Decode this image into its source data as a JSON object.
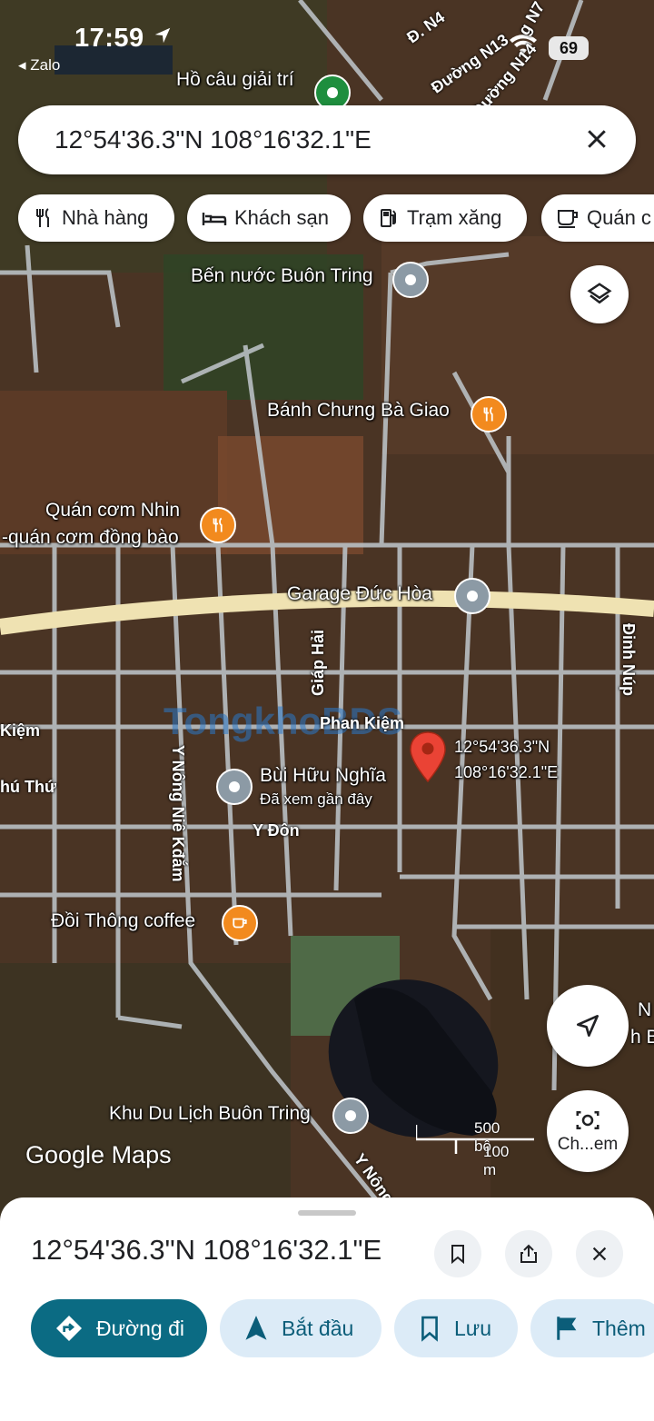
{
  "status_bar": {
    "time": "17:59",
    "back_app": "◂ Zalo",
    "battery": "69"
  },
  "search": {
    "query": "12°54'36.3\"N 108°16'32.1\"E"
  },
  "chips": [
    {
      "label": "Nhà hàng",
      "icon": "restaurant-icon"
    },
    {
      "label": "Khách sạn",
      "icon": "hotel-icon"
    },
    {
      "label": "Trạm xăng",
      "icon": "gas-station-icon"
    },
    {
      "label": "Quán c",
      "icon": "cafe-icon"
    }
  ],
  "map": {
    "places": {
      "ho_cau": "Hồ câu giải trí",
      "ben_nuoc": "Bến nước Buôn Tring",
      "banh_chung": "Bánh Chưng Bà Giao",
      "quan_com_1": "Quán cơm Nhin",
      "quan_com_2": "-quán cơm đồng bào",
      "garage": "Garage Đức Hòa",
      "bui_huu_nghia": "Bùi Hữu Nghĩa",
      "recently_viewed": "Đã xem gần đây",
      "doi_thong": "Đồi Thông coffee",
      "khu_du_lich": "Khu Du Lịch Buôn Tring"
    },
    "streets": {
      "d_n4": "Đ. N4",
      "duong_n13": "Đường N13",
      "duong_n14": "Đường N14",
      "n7": "g N7",
      "giap_hai": "Giáp Hải",
      "phan_kiem": "Phan Kiệm",
      "kiem_left": "Kiệm",
      "thu_left": "hú Thứ",
      "y_nong_nie": "Y Nông Niê Kđắm",
      "y_don": "Y Đôn",
      "dinh_nup": "Đinh Núp",
      "y_nong_bottom": "Y Nông",
      "right_n": "N",
      "right_hb": "h B"
    },
    "pin_coords_lat": "12°54'36.3\"N",
    "pin_coords_lng": "108°16'32.1\"E",
    "watermark": "TongkhoBDS",
    "scale_ft": "500 bộ",
    "scale_m": "100 m",
    "logo": "Google Maps",
    "screenshot_button_label": "Ch...em"
  },
  "sheet": {
    "title": "12°54'36.3\"N 108°16'32.1\"E",
    "actions": [
      {
        "label": "Đường đi",
        "icon": "directions-icon"
      },
      {
        "label": "Bắt đầu",
        "icon": "navigation-arrow-icon"
      },
      {
        "label": "Lưu",
        "icon": "bookmark-icon"
      },
      {
        "label": "Thêm",
        "icon": "flag-icon"
      }
    ]
  },
  "colors": {
    "accent": "#0b6b83",
    "pin_red": "#ea4335",
    "food_pin": "#f28a1e",
    "poi_grey": "#8c9aa5"
  }
}
